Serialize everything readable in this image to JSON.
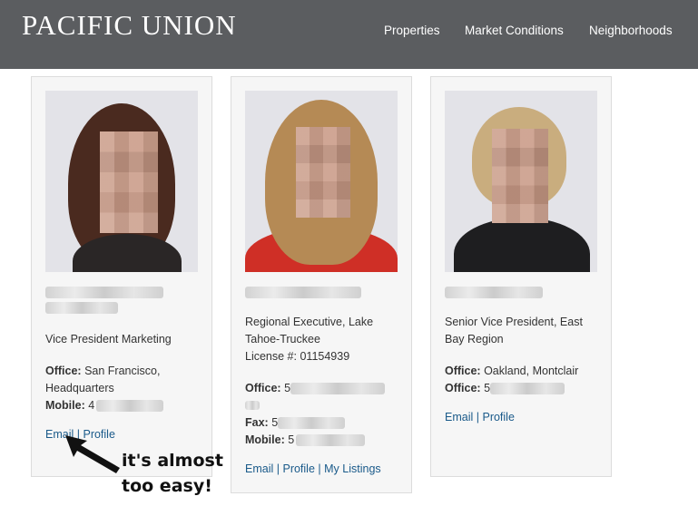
{
  "header": {
    "logo": "PACIFIC UNION",
    "nav": [
      "Properties",
      "Market Conditions",
      "Neighborhoods"
    ]
  },
  "agents": [
    {
      "title_lines": [
        "Vice President Marketing"
      ],
      "office_label": "Office:",
      "office_value_lines": [
        "San Francisco,",
        "Headquarters"
      ],
      "mobile_label": "Mobile:",
      "mobile_prefix": "4",
      "links": [
        "Email",
        "Profile"
      ],
      "link_sep": "|"
    },
    {
      "title_lines": [
        "Regional Executive, Lake",
        "Tahoe-Truckee"
      ],
      "license_label": "License #:",
      "license_value": "01154939",
      "office_label": "Office:",
      "office_prefix": "5",
      "fax_label": "Fax:",
      "fax_prefix": "5",
      "mobile_label": "Mobile:",
      "mobile_prefix": "5",
      "links": [
        "Email",
        "Profile",
        "My Listings"
      ],
      "link_sep": "|"
    },
    {
      "title_lines": [
        "Senior Vice President, East",
        "Bay Region"
      ],
      "office_label": "Office:",
      "office_value_lines": [
        "Oakland, Montclair"
      ],
      "office2_label": "Office:",
      "office2_prefix": "5",
      "links": [
        "Email",
        "Profile"
      ],
      "link_sep": "|"
    }
  ],
  "annotation": {
    "lines": [
      "it's almost",
      "too easy!"
    ]
  },
  "colors": {
    "header_bg": "#5b5d60",
    "link": "#1a5a8a",
    "card_bg": "#f6f6f6"
  }
}
